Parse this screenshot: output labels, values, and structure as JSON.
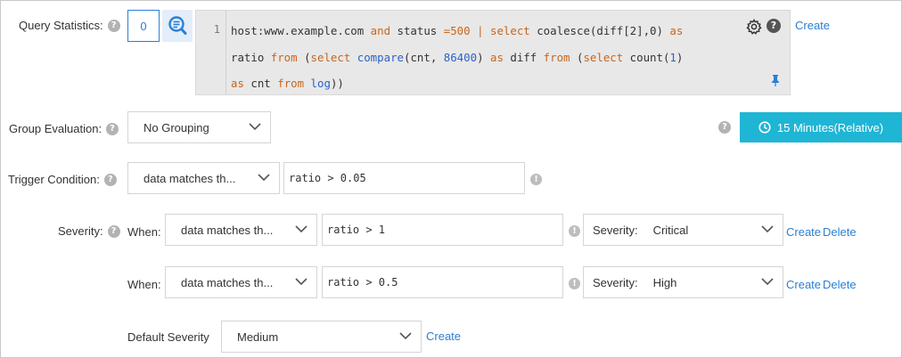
{
  "query_statistics": {
    "label": "Query Statistics:",
    "help": "?",
    "count": "0",
    "line_number": "1",
    "create_label": "Create"
  },
  "group_evaluation": {
    "label": "Group Evaluation:",
    "help": "?",
    "value": "No Grouping"
  },
  "time_range": {
    "help": "?",
    "label": "15 Minutes(Relative)"
  },
  "trigger_condition": {
    "label": "Trigger Condition:",
    "help": "?",
    "mode": "data matches th...",
    "expression": "ratio > 0.05",
    "warn": "!"
  },
  "severity": {
    "label": "Severity:",
    "help": "?",
    "rules": [
      {
        "when_label": "When:",
        "mode": "data matches th...",
        "expression": "ratio > 1",
        "warn": "!",
        "severity_label": "Severity:",
        "severity_value": "Critical",
        "create_label": "Create",
        "delete_label": "Delete"
      },
      {
        "when_label": "When:",
        "mode": "data matches th...",
        "expression": "ratio > 0.5",
        "warn": "!",
        "severity_label": "Severity:",
        "severity_value": "High",
        "create_label": "Create",
        "delete_label": "Delete"
      }
    ]
  },
  "default_severity": {
    "label": "Default Severity",
    "value": "Medium",
    "create_label": "Create"
  },
  "colors": {
    "accent": "#2a7fd4",
    "time_button": "#1fb5d4",
    "keyword": "#c8661c",
    "function": "#2a63c8"
  }
}
